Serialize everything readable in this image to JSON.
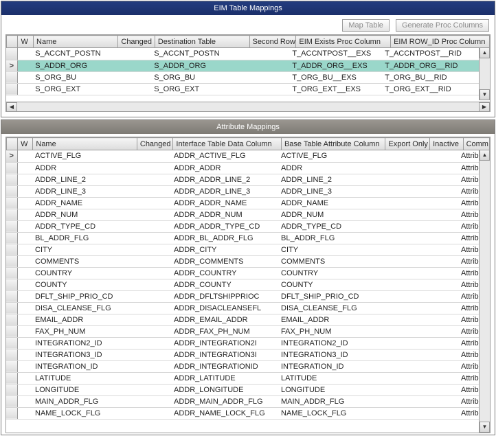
{
  "top": {
    "title": "EIM Table Mappings",
    "buttons": {
      "map": "Map Table",
      "gen": "Generate Proc Columns"
    },
    "columns": [
      "",
      "W",
      "Name",
      "Changed",
      "Destination Table",
      "Second Row",
      "EIM Exists Proc Column",
      "EIM ROW_ID Proc Column"
    ],
    "rows": [
      {
        "sel": false,
        "name": "S_ACCNT_POSTN",
        "dest": "S_ACCNT_POSTN",
        "exs": "T_ACCNTPOST__EXS",
        "rid": "T_ACCNTPOST__RID"
      },
      {
        "sel": true,
        "name": "S_ADDR_ORG",
        "dest": "S_ADDR_ORG",
        "exs": "T_ADDR_ORG__EXS",
        "rid": "T_ADDR_ORG__RID"
      },
      {
        "sel": false,
        "name": "S_ORG_BU",
        "dest": "S_ORG_BU",
        "exs": "T_ORG_BU__EXS",
        "rid": "T_ORG_BU__RID"
      },
      {
        "sel": false,
        "name": "S_ORG_EXT",
        "dest": "S_ORG_EXT",
        "exs": "T_ORG_EXT__EXS",
        "rid": "T_ORG_EXT__RID"
      }
    ]
  },
  "bottom": {
    "title": "Attribute Mappings",
    "columns": [
      "",
      "W",
      "Name",
      "Changed",
      "Interface Table Data Column",
      "Base Table Attribute Column",
      "Export Only",
      "Inactive",
      "Comm"
    ],
    "rows": [
      {
        "sel": true,
        "name": "ACTIVE_FLG",
        "ifc": "ADDR_ACTIVE_FLG",
        "base": "ACTIVE_FLG",
        "last": "Attribu"
      },
      {
        "sel": false,
        "name": "ADDR",
        "ifc": "ADDR_ADDR",
        "base": "ADDR",
        "last": "Attribu"
      },
      {
        "sel": false,
        "name": "ADDR_LINE_2",
        "ifc": "ADDR_ADDR_LINE_2",
        "base": "ADDR_LINE_2",
        "last": "Attribu"
      },
      {
        "sel": false,
        "name": "ADDR_LINE_3",
        "ifc": "ADDR_ADDR_LINE_3",
        "base": "ADDR_LINE_3",
        "last": "Attribu"
      },
      {
        "sel": false,
        "name": "ADDR_NAME",
        "ifc": "ADDR_ADDR_NAME",
        "base": "ADDR_NAME",
        "last": "Attribu"
      },
      {
        "sel": false,
        "name": "ADDR_NUM",
        "ifc": "ADDR_ADDR_NUM",
        "base": "ADDR_NUM",
        "last": "Attribu"
      },
      {
        "sel": false,
        "name": "ADDR_TYPE_CD",
        "ifc": "ADDR_ADDR_TYPE_CD",
        "base": "ADDR_TYPE_CD",
        "last": "Attribu"
      },
      {
        "sel": false,
        "name": "BL_ADDR_FLG",
        "ifc": "ADDR_BL_ADDR_FLG",
        "base": "BL_ADDR_FLG",
        "last": "Attribu"
      },
      {
        "sel": false,
        "name": "CITY",
        "ifc": "ADDR_CITY",
        "base": "CITY",
        "last": "Attribu"
      },
      {
        "sel": false,
        "name": "COMMENTS",
        "ifc": "ADDR_COMMENTS",
        "base": "COMMENTS",
        "last": "Attribu"
      },
      {
        "sel": false,
        "name": "COUNTRY",
        "ifc": "ADDR_COUNTRY",
        "base": "COUNTRY",
        "last": "Attribu"
      },
      {
        "sel": false,
        "name": "COUNTY",
        "ifc": "ADDR_COUNTY",
        "base": "COUNTY",
        "last": "Attribu"
      },
      {
        "sel": false,
        "name": "DFLT_SHIP_PRIO_CD",
        "ifc": "ADDR_DFLTSHIPPRIOC",
        "base": "DFLT_SHIP_PRIO_CD",
        "last": "Attribu"
      },
      {
        "sel": false,
        "name": "DISA_CLEANSE_FLG",
        "ifc": "ADDR_DISACLEANSEFL",
        "base": "DISA_CLEANSE_FLG",
        "last": "Attribu"
      },
      {
        "sel": false,
        "name": "EMAIL_ADDR",
        "ifc": "ADDR_EMAIL_ADDR",
        "base": "EMAIL_ADDR",
        "last": "Attribu"
      },
      {
        "sel": false,
        "name": "FAX_PH_NUM",
        "ifc": "ADDR_FAX_PH_NUM",
        "base": "FAX_PH_NUM",
        "last": "Attribu"
      },
      {
        "sel": false,
        "name": "INTEGRATION2_ID",
        "ifc": "ADDR_INTEGRATION2I",
        "base": "INTEGRATION2_ID",
        "last": "Attribu"
      },
      {
        "sel": false,
        "name": "INTEGRATION3_ID",
        "ifc": "ADDR_INTEGRATION3I",
        "base": "INTEGRATION3_ID",
        "last": "Attribu"
      },
      {
        "sel": false,
        "name": "INTEGRATION_ID",
        "ifc": "ADDR_INTEGRATIONID",
        "base": "INTEGRATION_ID",
        "last": "Attribu"
      },
      {
        "sel": false,
        "name": "LATITUDE",
        "ifc": "ADDR_LATITUDE",
        "base": "LATITUDE",
        "last": "Attribu"
      },
      {
        "sel": false,
        "name": "LONGITUDE",
        "ifc": "ADDR_LONGITUDE",
        "base": "LONGITUDE",
        "last": "Attribu"
      },
      {
        "sel": false,
        "name": "MAIN_ADDR_FLG",
        "ifc": "ADDR_MAIN_ADDR_FLG",
        "base": "MAIN_ADDR_FLG",
        "last": "Attribu"
      },
      {
        "sel": false,
        "name": "NAME_LOCK_FLG",
        "ifc": "ADDR_NAME_LOCK_FLG",
        "base": "NAME_LOCK_FLG",
        "last": "Attribu"
      }
    ]
  }
}
